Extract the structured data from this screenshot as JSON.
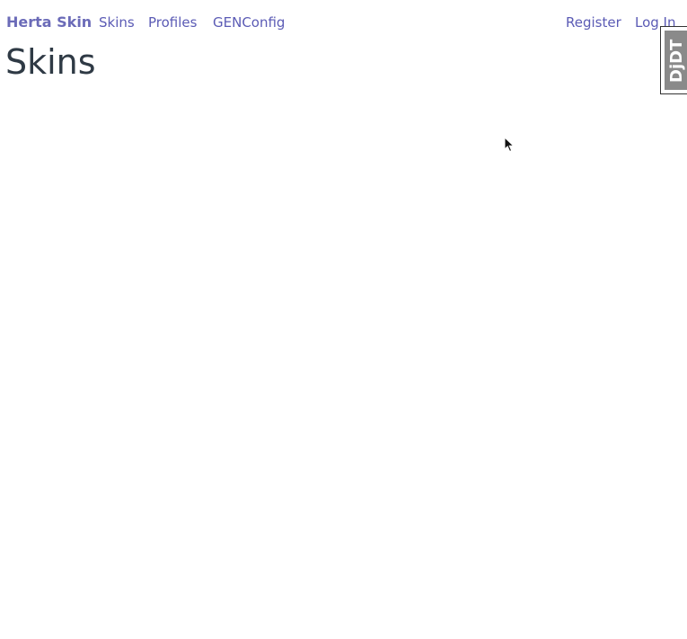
{
  "nav": {
    "brand": "Herta Skin",
    "links": [
      "Skins",
      "Profiles",
      "GENConfig"
    ],
    "auth": {
      "register": "Register",
      "login": "Log In"
    }
  },
  "main": {
    "title": "Skins"
  },
  "debug_toolbar": {
    "label": "DjDT"
  },
  "colors": {
    "link": "#5b5bb5",
    "brand": "#6b6bb8",
    "title": "#2f3a45",
    "toolbar": "#8a8a8a"
  }
}
